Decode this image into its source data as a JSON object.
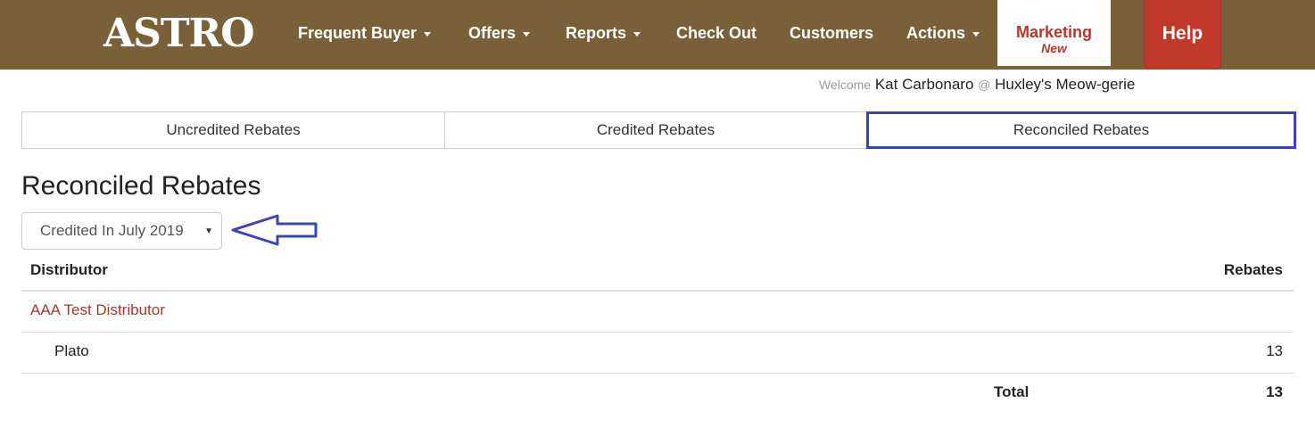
{
  "nav": {
    "logo": "ASTRO",
    "items": [
      {
        "label": "Frequent Buyer",
        "dropdown": true
      },
      {
        "label": "Offers",
        "dropdown": true
      },
      {
        "label": "Reports",
        "dropdown": true
      },
      {
        "label": "Check Out",
        "dropdown": false
      },
      {
        "label": "Customers",
        "dropdown": false
      },
      {
        "label": "Actions",
        "dropdown": true
      }
    ],
    "marketing": {
      "label": "Marketing",
      "badge": "New"
    },
    "help_label": "Help",
    "colors": {
      "bar": "#7a6038",
      "help": "#c0392b",
      "marketing_text": "#b03a2e"
    }
  },
  "welcome": {
    "prefix": "Welcome",
    "user": "Kat Carbonaro",
    "at": "@",
    "store": "Huxley's Meow-gerie"
  },
  "tabs": [
    {
      "label": "Uncredited Rebates",
      "active": false
    },
    {
      "label": "Credited Rebates",
      "active": false
    },
    {
      "label": "Reconciled Rebates",
      "active": true
    }
  ],
  "page_title": "Reconciled Rebates",
  "filter": {
    "selected": "Credited In July 2019"
  },
  "table": {
    "headers": {
      "distributor": "Distributor",
      "rebates": "Rebates"
    },
    "distributor": "AAA Test Distributor",
    "rows": [
      {
        "name": "Plato",
        "rebates": "13"
      }
    ],
    "total_label": "Total",
    "total_value": "13"
  },
  "annotation_color": "#3b45b8",
  "accent_link_color": "#a33a2a"
}
